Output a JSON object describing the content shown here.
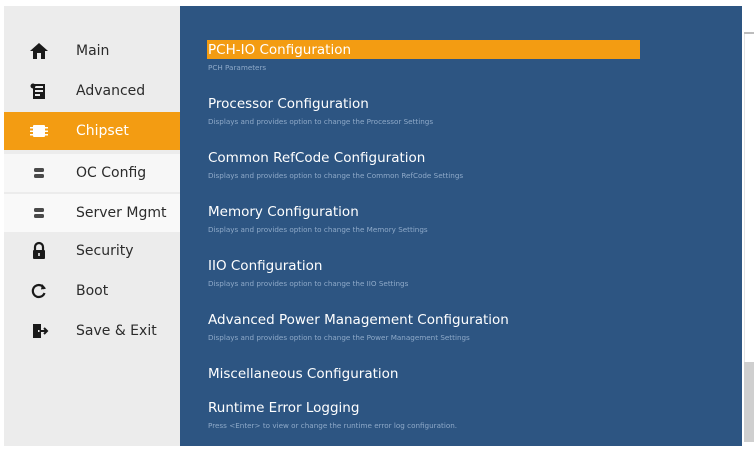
{
  "sidebar": {
    "items": [
      {
        "label": "Main",
        "icon": "home-icon"
      },
      {
        "label": "Advanced",
        "icon": "advanced-icon"
      },
      {
        "label": "Chipset",
        "icon": "chip-icon"
      },
      {
        "label": "OC Config",
        "icon": "oc-config-icon"
      },
      {
        "label": "Server Mgmt",
        "icon": "server-icon"
      },
      {
        "label": "Security",
        "icon": "lock-icon"
      },
      {
        "label": "Boot",
        "icon": "reload-icon"
      },
      {
        "label": "Save & Exit",
        "icon": "exit-icon"
      }
    ],
    "active_index": 2
  },
  "main": {
    "entries": [
      {
        "title": "PCH-IO Configuration",
        "desc": "PCH Parameters"
      },
      {
        "title": "Processor Configuration",
        "desc": "Displays and provides option to change the Processor Settings"
      },
      {
        "title": "Common RefCode Configuration",
        "desc": "Displays and provides option to change the Common RefCode Settings"
      },
      {
        "title": "Memory Configuration",
        "desc": "Displays and provides option to change the Memory Settings"
      },
      {
        "title": "IIO Configuration",
        "desc": "Displays and provides option to change the IIO Settings"
      },
      {
        "title": "Advanced Power Management Configuration",
        "desc": "Displays and provides option to change the Power Management Settings"
      },
      {
        "title": "Miscellaneous Configuration",
        "desc": ""
      },
      {
        "title": "Runtime Error Logging",
        "desc": "Press <Enter> to view or change the runtime error log configuration."
      }
    ],
    "selected_index": 0
  },
  "colors": {
    "accent": "#f39c12",
    "panel": "#2d5582",
    "sidebar": "#ececec",
    "desc_text": "#8ea9c8"
  }
}
